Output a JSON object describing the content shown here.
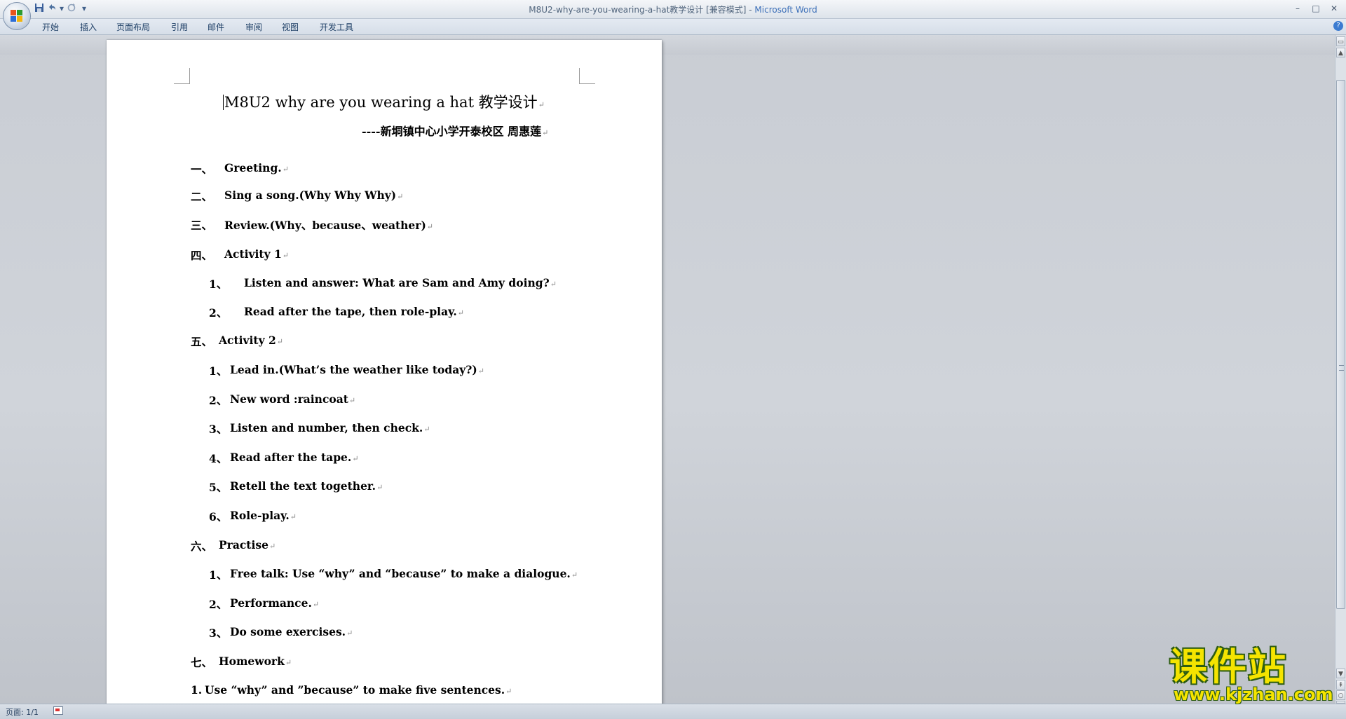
{
  "window": {
    "title_doc": "M8U2-why-are-you-wearing-a-hat教学设计 [兼容模式] - ",
    "title_app": "Microsoft Word",
    "minimize": "–",
    "maximize": "□",
    "close": "✕"
  },
  "quick_access": {
    "save_icon": "save-icon",
    "undo_icon": "undo-icon",
    "redo_icon": "redo-icon",
    "dropdown": "▾"
  },
  "ribbon": {
    "tabs": [
      "开始",
      "插入",
      "页面布局",
      "引用",
      "邮件",
      "审阅",
      "视图",
      "开发工具"
    ],
    "help": "?"
  },
  "document": {
    "title": "M8U2 why are you wearing a hat 教学设计",
    "subtitle": "----新垌镇中心小学开泰校区   周惠莲",
    "paragraph_mark": "↵",
    "lines": [
      {
        "num": "一、",
        "text": "Greeting."
      },
      {
        "num": "二、",
        "text": "Sing a song.(Why    Why    Why)"
      },
      {
        "num": "三、",
        "text": "Review.(Why、because、weather)"
      },
      {
        "num": "四、",
        "text": "Activity 1"
      },
      {
        "num": "1、",
        "text": "Listen and answer: What are Sam and Amy doing?"
      },
      {
        "num": "2、",
        "text": "Read after the tape, then role-play."
      },
      {
        "num": "五、",
        "text": "Activity 2"
      },
      {
        "num": "1、",
        "text": "Lead in.(What’s the weather like today?)"
      },
      {
        "num": "2、",
        "text": "New word :raincoat"
      },
      {
        "num": "3、",
        "text": "Listen and number, then check."
      },
      {
        "num": "4、",
        "text": "Read after the tape."
      },
      {
        "num": "5、",
        "text": "Retell the text together."
      },
      {
        "num": "6、",
        "text": "Role-play."
      },
      {
        "num": "六、",
        "text": "Practise"
      },
      {
        "num": "1、",
        "text": "Free talk: Use “why” and “because” to make a dialogue."
      },
      {
        "num": "2、",
        "text": "Performance."
      },
      {
        "num": "3、",
        "text": "Do some exercises."
      },
      {
        "num": "七、",
        "text": "Homework"
      },
      {
        "num": "1.",
        "text": "Use   “why”   and   ”because”   to make five sentences."
      }
    ]
  },
  "statusbar": {
    "page": "页面: 1/1"
  },
  "watermark": {
    "cn": "课件站",
    "url": "www.kjzhan.com"
  },
  "colors": {
    "accent": "#3c6fb8",
    "workspace": "#c8ccd3",
    "watermark": "#f5e400"
  }
}
